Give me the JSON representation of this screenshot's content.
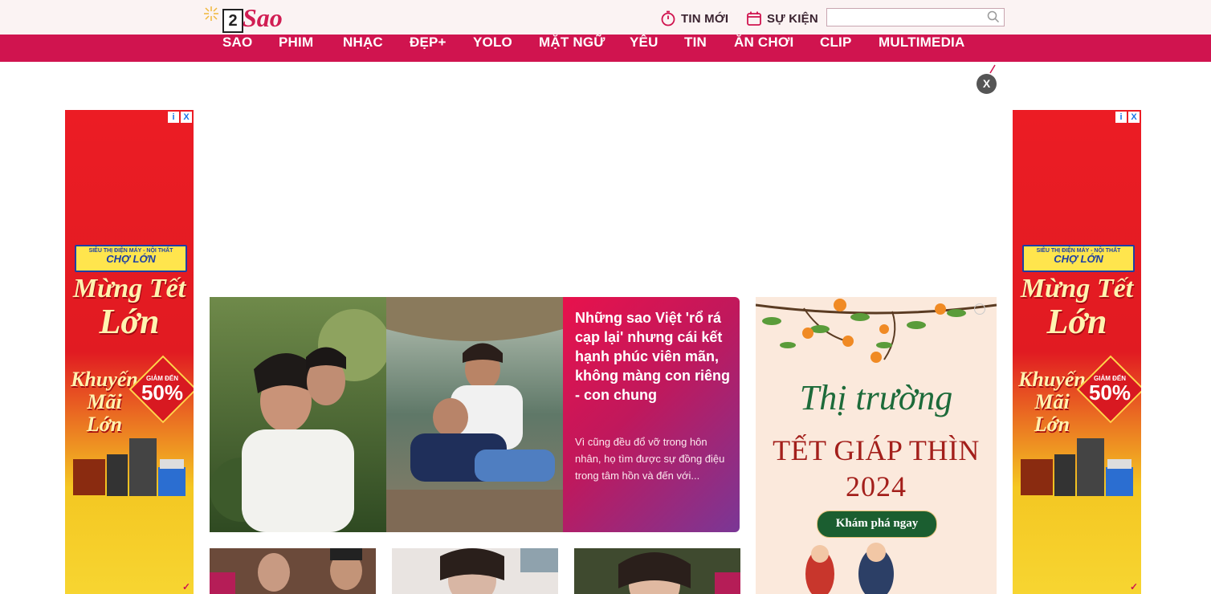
{
  "header": {
    "logo_number": "2",
    "logo_text": "Sao",
    "tin_moi": "TIN MỚI",
    "su_kien": "SỰ KIỆN",
    "search_placeholder": ""
  },
  "nav": {
    "items": [
      "SAO",
      "PHIM",
      "NHẠC",
      "ĐẸP+",
      "YOLO",
      "MẶT NGỮ",
      "YÊU",
      "TIN",
      "ĂN CHƠI",
      "CLIP",
      "MULTIMEDIA"
    ]
  },
  "close_button": "X",
  "side_ad": {
    "brand_line1": "SIÊU THỊ ĐIỆN MÁY - NỘI THẤT",
    "brand_line2": "CHỢ LỚN",
    "title_line1": "Mừng Tết",
    "title_line2": "Lớn",
    "promo_line1": "Khuyến",
    "promo_line2": "Mãi",
    "promo_line3": "Lớn",
    "discount_label": "GIẢM ĐẾN",
    "discount_value": "50%",
    "info_icon": "i",
    "close_icon": "X"
  },
  "featured": {
    "title": "Những sao Việt 'rổ rá cạp lại' nhưng cái kết hạnh phúc viên mãn, không màng con riêng - con chung",
    "summary": "Vì cũng đều đổ vỡ trong hôn nhân, họ tìm được sự đồng điệu trong tâm hồn và đến với..."
  },
  "right_ad": {
    "script": "Thị trường",
    "title": "TẾT GIÁP THÌN",
    "year": "2024",
    "button": "Khám phá ngay"
  },
  "colors": {
    "brand": "#d0144f",
    "topbar": "#fbf3f3",
    "caption_start": "#e8124c",
    "caption_end": "#7a3796"
  }
}
